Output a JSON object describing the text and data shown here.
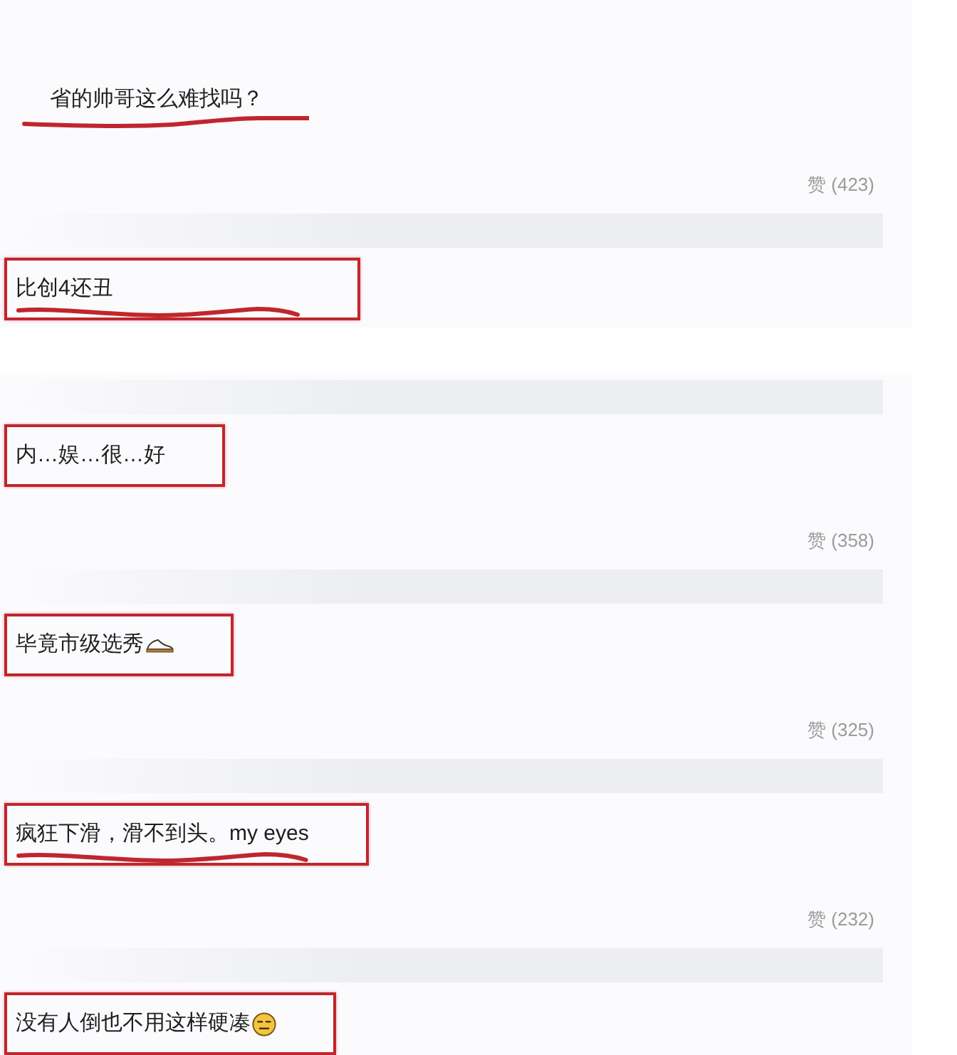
{
  "sections": [
    {
      "comments": [
        {
          "kind": "text",
          "redacted_author": false,
          "text": "省的帅哥这么难找吗？",
          "boxed": false,
          "underlined": true,
          "likes": "赞 (423)"
        },
        {
          "kind": "text",
          "redacted_author": true,
          "text": "比创4还丑",
          "boxed": true,
          "underlined": true
        }
      ]
    },
    {
      "comments": [
        {
          "kind": "text",
          "redacted_author": true,
          "text": "内…娱…很…好",
          "boxed": true,
          "underlined": false,
          "likes": "赞 (358)"
        },
        {
          "kind": "shoe",
          "redacted_author": true,
          "text": "毕竟市级选秀",
          "boxed": true,
          "underlined": false,
          "likes": "赞 (325)"
        },
        {
          "kind": "text",
          "redacted_author": true,
          "text": "疯狂下滑，滑不到头。my eyes",
          "boxed": true,
          "underlined": true,
          "likes": "赞 (232)"
        },
        {
          "kind": "face",
          "redacted_author": true,
          "text": "没有人倒也不用这样硬凑",
          "boxed": true,
          "underlined": false
        }
      ]
    }
  ]
}
